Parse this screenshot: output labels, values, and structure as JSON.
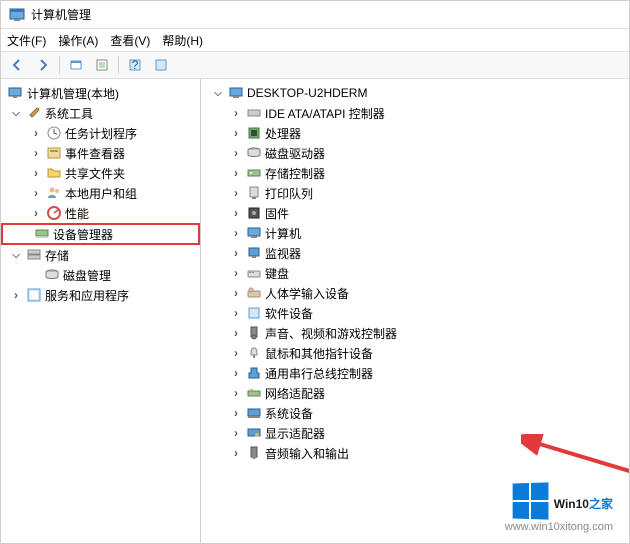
{
  "window": {
    "title": "计算机管理"
  },
  "menu": {
    "file": "文件(F)",
    "action": "操作(A)",
    "view": "查看(V)",
    "help": "帮助(H)"
  },
  "left": {
    "root": "计算机管理(本地)",
    "tools": "系统工具",
    "tools_items": [
      "任务计划程序",
      "事件查看器",
      "共享文件夹",
      "本地用户和组",
      "性能",
      "设备管理器"
    ],
    "storage": "存储",
    "disk": "磁盘管理",
    "services": "服务和应用程序"
  },
  "right": {
    "root": "DESKTOP-U2HDERM",
    "items": [
      "IDE ATA/ATAPI 控制器",
      "处理器",
      "磁盘驱动器",
      "存储控制器",
      "打印队列",
      "固件",
      "计算机",
      "监视器",
      "键盘",
      "人体学输入设备",
      "软件设备",
      "声音、视频和游戏控制器",
      "鼠标和其他指针设备",
      "通用串行总线控制器",
      "网络适配器",
      "系统设备",
      "显示适配器",
      "音频输入和输出"
    ]
  },
  "watermark": {
    "text1": "Win10",
    "text2": "之家",
    "url": "www.win10xitong.com"
  }
}
